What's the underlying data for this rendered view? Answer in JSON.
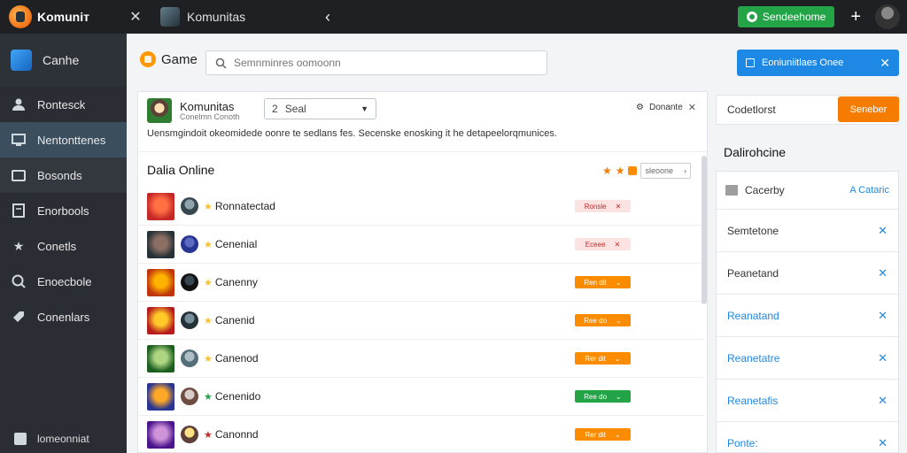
{
  "topbar": {
    "app_name": "Komuniт",
    "close_icon": "✕",
    "window_title": "Komunitas",
    "back_icon": "‹",
    "green_button": "Sendeehome",
    "plus_icon": "+"
  },
  "sidebar": {
    "items": [
      {
        "label": "Canhe",
        "icon": "game-icon"
      },
      {
        "label": "Rontesck",
        "icon": "person-icon"
      },
      {
        "label": "Nentonttenes",
        "icon": "monitor-icon"
      },
      {
        "label": "Bosonds",
        "icon": "folder-icon"
      },
      {
        "label": "Enorbools",
        "icon": "document-icon"
      },
      {
        "label": "Conetls",
        "icon": "star-icon"
      },
      {
        "label": "Enoecbole",
        "icon": "chat-icon"
      },
      {
        "label": "Conenlars",
        "icon": "tag-icon"
      }
    ],
    "bottom_label": "lomeonniat"
  },
  "header": {
    "game_title": "Game",
    "search_placeholder": "Semnminres oomoonn",
    "banner_text": "Eoniuniitlaes Onee",
    "banner_close": "✕"
  },
  "community": {
    "name": "Komunitas",
    "subtitle": "Conelmn Conoth",
    "select_value": "Seal",
    "select_number": "2",
    "donate_label": "Donante",
    "description": "Uensmgindoit okeomidede oonre te sedlans fes. Secenske enosking it he detapeelorqmunices."
  },
  "list": {
    "title": "Dalia Online",
    "sort_label": "sleoone",
    "rows": [
      {
        "name": "Ronnatectad",
        "pill": "Ronsle",
        "pill_style": "pink",
        "pill_icon": "✕",
        "star_color": "#fbc02d",
        "img": [
          "#c62828",
          "#ff7043"
        ],
        "avatar": [
          "#90a4ae",
          "#37474f"
        ]
      },
      {
        "name": "Cenenial",
        "pill": "Eceee",
        "pill_style": "pink",
        "pill_icon": "✕",
        "star_color": "#fbc02d",
        "img": [
          "#263238",
          "#8d6e63"
        ],
        "avatar": [
          "#5c6bc0",
          "#283593"
        ]
      },
      {
        "name": "Canenny",
        "pill": "Ren dit",
        "pill_style": "orange",
        "pill_icon": "⌄",
        "star_color": "#fbc02d",
        "img": [
          "#bf360c",
          "#ffb300"
        ],
        "avatar": [
          "#37474f",
          "#111111"
        ]
      },
      {
        "name": "Canenid",
        "pill": "Ree do",
        "pill_style": "orange",
        "pill_icon": "⌄",
        "star_color": "#fbc02d",
        "img": [
          "#b71c1c",
          "#ffca28"
        ],
        "avatar": [
          "#78909c",
          "#263238"
        ]
      },
      {
        "name": "Canenod",
        "pill": "Rer dit",
        "pill_style": "orange",
        "pill_icon": "⌄",
        "star_color": "#fbc02d",
        "img": [
          "#1b5e20",
          "#aed581"
        ],
        "avatar": [
          "#b0bec5",
          "#546e7a"
        ]
      },
      {
        "name": "Cenenido",
        "pill": "Ree do",
        "pill_style": "green",
        "pill_icon": "⌄",
        "star_color": "#22a447",
        "img": [
          "#283593",
          "#ffa726"
        ],
        "avatar": [
          "#d7ccc8",
          "#6d4c41"
        ]
      },
      {
        "name": "Canonnd",
        "pill": "Rer dit",
        "pill_style": "orange",
        "pill_icon": "⌄",
        "star_color": "#c62828",
        "img": [
          "#4a148c",
          "#ce93d8"
        ],
        "avatar": [
          "#ffe082",
          "#5d4037"
        ]
      }
    ]
  },
  "right_panel": {
    "top_label": "Codetlorst",
    "orange_button": "Seneber",
    "title": "Dalirohcine",
    "head_label": "Cacerby",
    "head_link": "A Cataric",
    "rows": [
      {
        "label": "Semtetone",
        "color": "#333333"
      },
      {
        "label": "Peanetand",
        "color": "#333333"
      },
      {
        "label": "Reanatand",
        "color": "#1e88e5"
      },
      {
        "label": "Reanetatre",
        "color": "#1e88e5"
      },
      {
        "label": "Reanetafis",
        "color": "#1e88e5"
      },
      {
        "label": "Ponte:",
        "color": "#1e88e5"
      }
    ]
  }
}
